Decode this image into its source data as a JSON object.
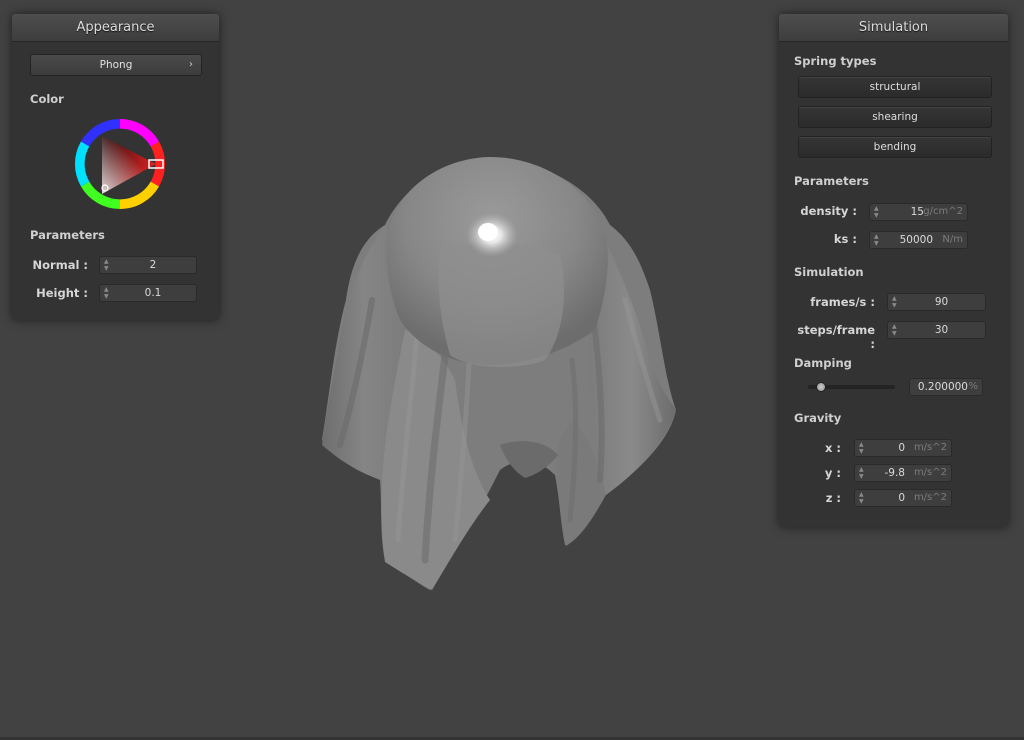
{
  "appearance": {
    "title": "Appearance",
    "shader_value": "Phong",
    "color_label": "Color",
    "params_label": "Parameters",
    "normal_label": "Normal :",
    "normal_value": "2",
    "height_label": "Height :",
    "height_value": "0.1"
  },
  "simulation": {
    "title": "Simulation",
    "spring_types_label": "Spring types",
    "springs": [
      "structural",
      "shearing",
      "bending"
    ],
    "parameters_label": "Parameters",
    "density_label": "density :",
    "density_value": "15",
    "density_unit": "g/cm^2",
    "ks_label": "ks :",
    "ks_value": "50000",
    "ks_unit": "N/m",
    "sim_label": "Simulation",
    "fps_label": "frames/s :",
    "fps_value": "90",
    "steps_label": "steps/frame :",
    "steps_value": "30",
    "damping_label": "Damping",
    "damping_value": "0.200000",
    "damping_unit": "%",
    "damping_level": 0.1,
    "gravity_label": "Gravity",
    "gx_label": "x :",
    "gx_value": "0",
    "gy_label": "y :",
    "gy_value": "-9.8",
    "gz_label": "z :",
    "gz_value": "0",
    "gravity_unit": "m/s^2"
  },
  "colors": {
    "background": "#424242",
    "panel": "#333333",
    "selected_color": "#d42020"
  }
}
